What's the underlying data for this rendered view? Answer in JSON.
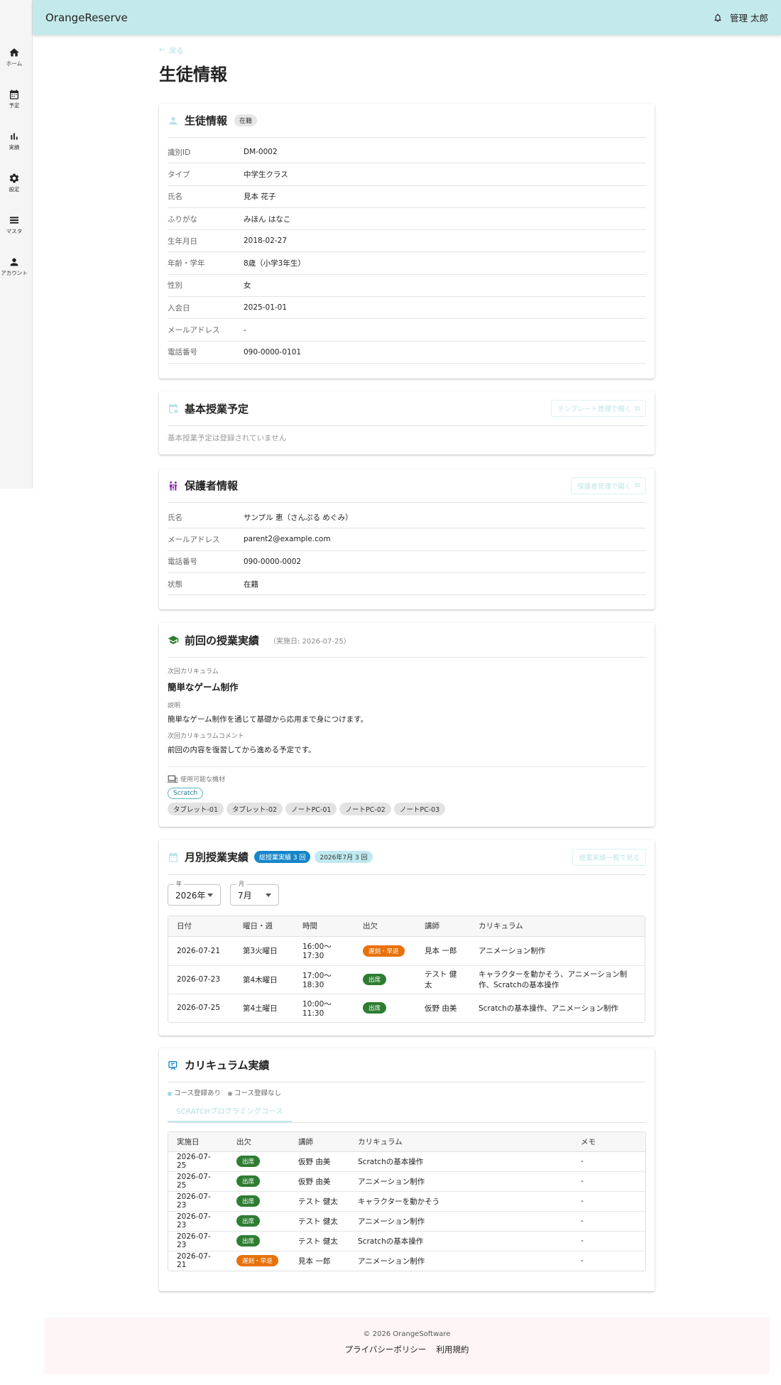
{
  "app": {
    "brand": "OrangeReserve",
    "user": "管理 太郎"
  },
  "sidebar": [
    {
      "label": "ホーム",
      "icon": "home-icon"
    },
    {
      "label": "予定",
      "icon": "calendar-icon"
    },
    {
      "label": "実績",
      "icon": "bar-chart-icon"
    },
    {
      "label": "設定",
      "icon": "gear-icon"
    },
    {
      "label": "マスタ",
      "icon": "list-icon"
    },
    {
      "label": "アカウント",
      "icon": "person-icon"
    }
  ],
  "page": {
    "back_label": "戻る",
    "title": "生徒情報"
  },
  "student": {
    "title": "生徒情報",
    "status": "在籍",
    "rows": [
      {
        "key": "識別ID",
        "value": "DM-0002"
      },
      {
        "key": "タイプ",
        "value": "中学生クラス"
      },
      {
        "key": "氏名",
        "value": "見本 花子"
      },
      {
        "key": "ふりがな",
        "value": "みほん はなこ"
      },
      {
        "key": "生年月日",
        "value": "2018-02-27"
      },
      {
        "key": "年齢・学年",
        "value": "8歳（小学3年生）"
      },
      {
        "key": "性別",
        "value": "女"
      },
      {
        "key": "入会日",
        "value": "2025-01-01"
      },
      {
        "key": "メールアドレス",
        "value": "-"
      },
      {
        "key": "電話番号",
        "value": "090-0000-0101"
      }
    ]
  },
  "schedule": {
    "title": "基本授業予定",
    "button": "テンプレート管理で開く",
    "empty": "基本授業予定は登録されていません"
  },
  "guardian": {
    "title": "保護者情報",
    "button": "保護者管理で開く",
    "rows": [
      {
        "key": "氏名",
        "value": "サンプル 恵（さんぷる めぐみ）"
      },
      {
        "key": "メールアドレス",
        "value": "parent2@example.com"
      },
      {
        "key": "電話番号",
        "value": "090-0000-0002"
      },
      {
        "key": "状態",
        "value": "在籍"
      }
    ]
  },
  "last_lesson": {
    "title": "前回の授業実績",
    "date_note": "（実施日: 2026-07-25）",
    "next_curriculum_label": "次回カリキュラム",
    "next_curriculum": "簡単なゲーム制作",
    "desc_label": "説明",
    "desc": "簡単なゲーム制作を通じて基礎から応用まで身につけます。",
    "comment_label": "次回カリキュラムコメント",
    "comment": "前回の内容を復習してから進める予定です。",
    "equipment_label": "使用可能な機材",
    "software": "Scratch",
    "devices": [
      "タブレット-01",
      "タブレット-02",
      "ノートPC-01",
      "ノートPC-02",
      "ノートPC-03"
    ]
  },
  "monthly": {
    "title": "月別授業実績",
    "total_chip": "総授業実績 3 回",
    "month_chip": "2026年7月 3 回",
    "button": "授業実績一覧で見る",
    "year_caption": "年",
    "year": "2026年",
    "month_caption": "月",
    "month": "7月",
    "headers": [
      "日付",
      "曜日・週",
      "時間",
      "出欠",
      "講師",
      "カリキュラム"
    ],
    "rows": [
      {
        "date": "2026-07-21",
        "week": "第3火曜日",
        "time1": "16:00〜",
        "time2": "17:30",
        "att": "遅刻・早退",
        "att_color": "#e8710a",
        "teacher1": "見本 一郎",
        "teacher2": "",
        "curr1": "アニメーション制作",
        "curr2": ""
      },
      {
        "date": "2026-07-23",
        "week": "第4木曜日",
        "time1": "17:00〜",
        "time2": "18:30",
        "att": "出席",
        "att_color": "#2e7d32",
        "teacher1": "テスト 健",
        "teacher2": "太",
        "curr1": "キャラクターを動かそう、アニメーション制",
        "curr2": "作、Scratchの基本操作"
      },
      {
        "date": "2026-07-25",
        "week": "第4土曜日",
        "time1": "10:00〜",
        "time2": "11:30",
        "att": "出席",
        "att_color": "#2e7d32",
        "teacher1": "仮野 由美",
        "teacher2": "",
        "curr1": "Scratchの基本操作、アニメーション制作",
        "curr2": ""
      }
    ]
  },
  "curriculum": {
    "title": "カリキュラム実績",
    "legend_with": "コース登録あり",
    "legend_without": "コース登録なし",
    "legend_with_color": "#9fd9de",
    "legend_without_color": "#9e9e9e",
    "course_tab": "SCRATCHプログラミングコース",
    "headers": [
      "実施日",
      "出欠",
      "講師",
      "カリキュラム",
      "メモ"
    ],
    "rows": [
      {
        "date": "2026-07-25",
        "att": "出席",
        "att_color": "#2e7d32",
        "teacher": "仮野 由美",
        "curr": "Scratchの基本操作",
        "memo": "-"
      },
      {
        "date": "2026-07-25",
        "att": "出席",
        "att_color": "#2e7d32",
        "teacher": "仮野 由美",
        "curr": "アニメーション制作",
        "memo": "-"
      },
      {
        "date": "2026-07-23",
        "att": "出席",
        "att_color": "#2e7d32",
        "teacher": "テスト 健太",
        "curr": "キャラクターを動かそう",
        "memo": "-"
      },
      {
        "date": "2026-07-23",
        "att": "出席",
        "att_color": "#2e7d32",
        "teacher": "テスト 健太",
        "curr": "アニメーション制作",
        "memo": "-"
      },
      {
        "date": "2026-07-23",
        "att": "出席",
        "att_color": "#2e7d32",
        "teacher": "テスト 健太",
        "curr": "Scratchの基本操作",
        "memo": "-"
      },
      {
        "date": "2026-07-21",
        "att": "遅刻・早退",
        "att_color": "#e8710a",
        "teacher": "見本 一郎",
        "curr": "アニメーション制作",
        "memo": "-"
      }
    ]
  },
  "footer": {
    "copyright": "© 2026 OrangeSoftware",
    "privacy": "プライバシーポリシー",
    "terms": "利用規約"
  }
}
